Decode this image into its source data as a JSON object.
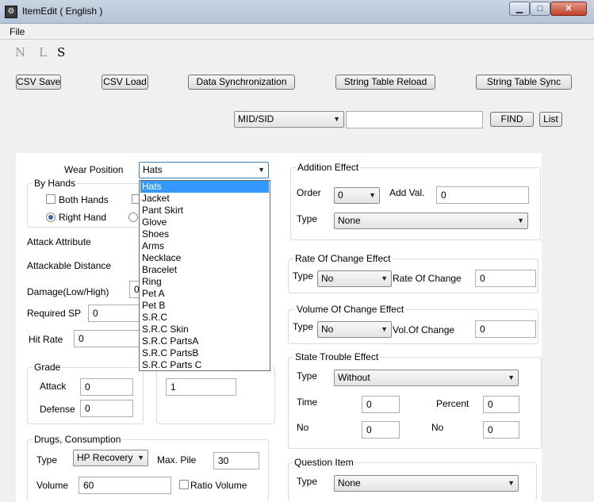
{
  "window": {
    "title": "ItemEdit ( English )",
    "icon": "item-edit-app-icon"
  },
  "menu": {
    "file": "File"
  },
  "mode_letters": [
    "N",
    "L",
    "S"
  ],
  "toolbar": {
    "csv_save": "CSV Save",
    "csv_load": "CSV Load",
    "data_sync": "Data Synchronization",
    "string_table_reload": "String Table Reload",
    "string_table_sync": "String Table Sync"
  },
  "search": {
    "mode": "MID/SID",
    "query": "",
    "find": "FIND",
    "list": "List"
  },
  "wear_position": {
    "label": "Wear Position",
    "selected": "Hats",
    "options": [
      "Hats",
      "Jacket",
      "Pant Skirt",
      "Glove",
      "Shoes",
      "Arms",
      "Necklace",
      "Bracelet",
      "Ring",
      "Pet A",
      "Pet B",
      "S.R.C",
      "S.R.C Skin",
      "S.R.C PartsA",
      "S.R.C PartsB",
      "S.R.C Parts C"
    ]
  },
  "by_hands": {
    "title": "By Hands",
    "both_hands": "Both Hands",
    "right_hand": "Right Hand",
    "right_hand_selected": true
  },
  "left_fields": {
    "attack_attribute": "Attack Attribute",
    "attackable_distance": "Attackable Distance",
    "damage": "Damage(Low/High)",
    "damage_low": "0",
    "required_sp": "Required SP",
    "required_sp_value": "0",
    "hit_rate": "Hit Rate",
    "hit_rate_value": "0"
  },
  "grade": {
    "title": "Grade",
    "attack": "Attack",
    "attack_value": "0",
    "defense": "Defense",
    "defense_value": "0"
  },
  "unnamed_group": {
    "value": "1"
  },
  "drugs": {
    "title": "Drugs, Consumption",
    "type_label": "Type",
    "type_value": "HP Recovery",
    "max_pile_label": "Max. Pile",
    "max_pile_value": "30",
    "volume_label": "Volume",
    "volume_value": "60",
    "ratio_volume": "Ratio Volume"
  },
  "addition_effect": {
    "title": "Addition Effect",
    "order_label": "Order",
    "order_value": "0",
    "add_val_label": "Add Val.",
    "add_val": "0",
    "type_label": "Type",
    "type_value": "None"
  },
  "rate_change": {
    "title": "Rate Of Change Effect",
    "type_label": "Type",
    "type_value": "No",
    "rate_label": "Rate Of Change",
    "rate_value": "0"
  },
  "volume_change": {
    "title": "Volume Of Change Effect",
    "type_label": "Type",
    "type_value": "No",
    "vol_label": "Vol.Of Change",
    "vol_value": "0"
  },
  "state_trouble": {
    "title": "State Trouble Effect",
    "type_label": "Type",
    "type_value": "Without",
    "time_label": "Time",
    "time_value": "0",
    "percent_label": "Percent",
    "percent_value": "0",
    "no_label_1": "No",
    "no_value_1": "0",
    "no_label_2": "No",
    "no_value_2": "0"
  },
  "question_item": {
    "title": "Question Item",
    "type_label": "Type",
    "type_value": "None"
  }
}
